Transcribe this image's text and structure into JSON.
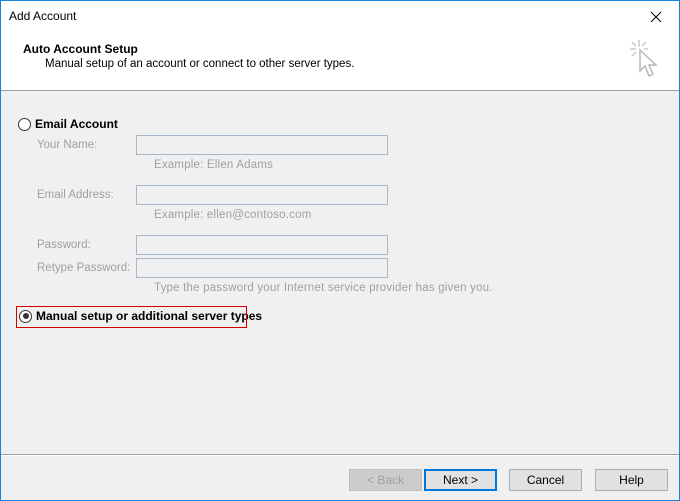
{
  "window": {
    "title": "Add Account",
    "close_icon": "close-icon"
  },
  "header": {
    "title": "Auto Account Setup",
    "subtitle": "Manual setup of an account or connect to other server types.",
    "icon": "wizard-cursor-icon"
  },
  "options": {
    "email_account": {
      "label": "Email Account",
      "checked": false
    },
    "manual_setup": {
      "label": "Manual setup or additional server types",
      "checked": true,
      "highlight_color": "#d00000"
    }
  },
  "fields": {
    "your_name": {
      "label": "Your Name:",
      "value": "",
      "hint": "Example: Ellen Adams"
    },
    "email_address": {
      "label": "Email Address:",
      "value": "",
      "hint": "Example: ellen@contoso.com"
    },
    "password": {
      "label": "Password:",
      "value": ""
    },
    "retype_password": {
      "label": "Retype Password:",
      "value": "",
      "hint": "Type the password your Internet service provider has given you."
    }
  },
  "buttons": {
    "back": {
      "label": "< Back",
      "enabled": false
    },
    "next": {
      "label": "Next >",
      "enabled": true,
      "default": true
    },
    "cancel": {
      "label": "Cancel",
      "enabled": true
    },
    "help": {
      "label": "Help",
      "enabled": true
    }
  },
  "colors": {
    "window_border": "#1883d7",
    "default_button_border": "#0078d7",
    "disabled_text": "#a0a0a0"
  }
}
